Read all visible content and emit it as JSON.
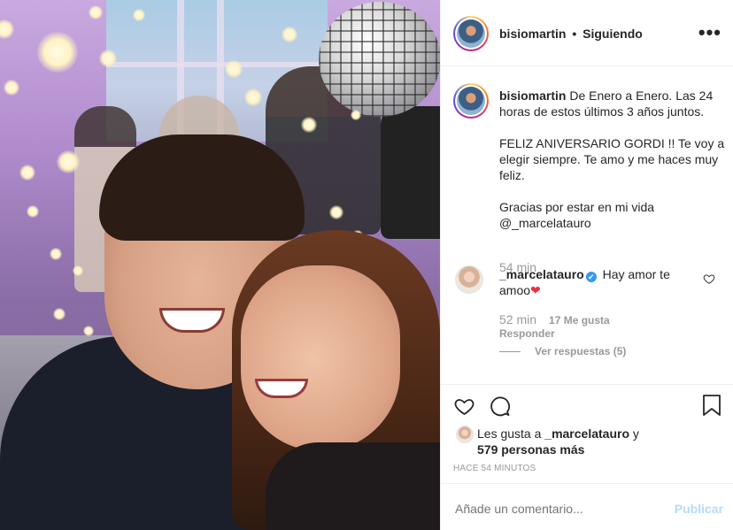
{
  "post": {
    "author": "bisiomartin",
    "follow_state": "Siguiendo",
    "separator": "•",
    "more_label": "•••"
  },
  "caption": {
    "author": "bisiomartin",
    "line1": "De Enero a Enero. Las 24 horas de estos últimos 3 años juntos.",
    "line2": "FELIZ ANIVERSARIO GORDI !! Te voy a elegir siempre. Te amo y me haces muy feliz.",
    "line3": "Gracias por estar en mi vida",
    "mention": "@_marcelatauro",
    "time": "54 min"
  },
  "comment": {
    "author": "_marcelatauro",
    "verified_mark": "✔",
    "text": "Hay amor te amoo",
    "emoji": "❤",
    "time": "52 min",
    "likes": "17 Me gusta",
    "reply_label": "Responder",
    "view_replies_label": "Ver respuestas (5)"
  },
  "likes": {
    "prefix": "Les gusta a",
    "first_user": "_marcelatauro",
    "connector": "y",
    "others": "579 personas más"
  },
  "posted_ago": "HACE 54 MINUTOS",
  "add_comment": {
    "placeholder": "Añade un comentario...",
    "publish_label": "Publicar"
  },
  "colors": {
    "link_blue": "#3897f0",
    "publish_disabled": "#b3dbff",
    "muted": "#999999",
    "heart_red": "#ed2d3e"
  },
  "icons": [
    "more-icon",
    "heart-icon",
    "comment-icon",
    "bookmark-icon",
    "verified-icon",
    "like-comment-icon"
  ]
}
